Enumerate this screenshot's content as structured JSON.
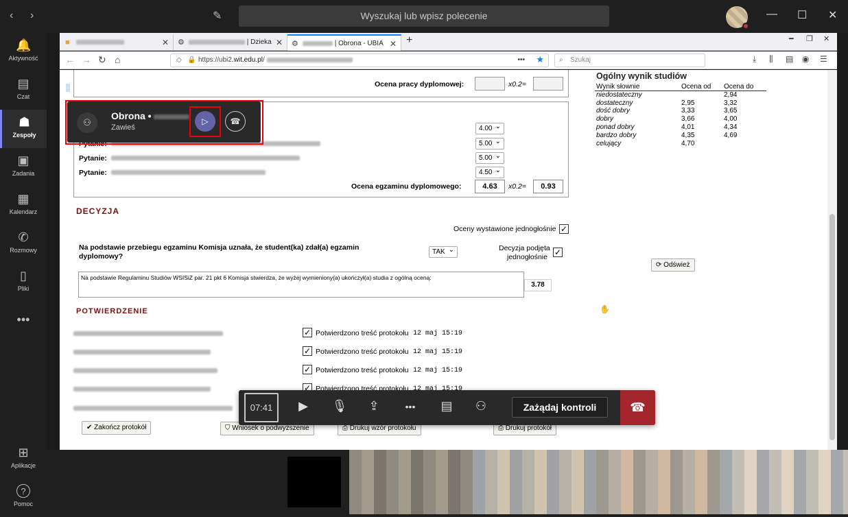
{
  "teams": {
    "search_placeholder": "Wyszukaj lub wpisz polecenie",
    "rail": [
      {
        "label": "Aktywność",
        "icon": "bell-icon",
        "glyph": "🔔"
      },
      {
        "label": "Czat",
        "icon": "chat-icon",
        "glyph": "▤"
      },
      {
        "label": "Zespoły",
        "icon": "teams-icon",
        "glyph": "☗",
        "active": true
      },
      {
        "label": "Zadania",
        "icon": "briefcase-icon",
        "glyph": "▣"
      },
      {
        "label": "Kalendarz",
        "icon": "calendar-icon",
        "glyph": "▦"
      },
      {
        "label": "Rozmowy",
        "icon": "phone-icon",
        "glyph": "✆"
      },
      {
        "label": "Pliki",
        "icon": "file-icon",
        "glyph": "▯"
      },
      {
        "label": "",
        "icon": "more-icon",
        "glyph": "•••"
      }
    ],
    "rail_bottom": [
      {
        "label": "Aplikacje",
        "icon": "apps-icon",
        "glyph": "⊞"
      },
      {
        "label": "Pomoc",
        "icon": "help-icon",
        "glyph": "?"
      }
    ],
    "call_card": {
      "title": "Obrona •",
      "subtitle": "Zawieś"
    },
    "controls": {
      "timer": "07:41",
      "request_control": "Zażądaj kontroli"
    }
  },
  "browser": {
    "tabs": [
      {
        "suffix": ""
      },
      {
        "suffix": "| Dzieka"
      },
      {
        "suffix": "| Obrona - UBIA",
        "active": true
      }
    ],
    "url_prefix": "https://ubi2.",
    "url_host": "wit.edu.pl",
    "url_suffix": "/",
    "search_placeholder": "Szukaj"
  },
  "form": {
    "ocena_pracy_label": "Ocena pracy dyplomowej:",
    "factor": "x0.2=",
    "questions": [
      {
        "label": "",
        "grade": "4.00"
      },
      {
        "label": "Pytanie:",
        "grade": "5.00"
      },
      {
        "label": "Pytanie:",
        "grade": "5.00"
      },
      {
        "label": "Pytanie:",
        "grade": "4.50"
      }
    ],
    "egzamin_label": "Ocena egzaminu dyplomowego:",
    "egzamin_value": "4.63",
    "egzamin_weighted": "0.93",
    "decyzja_heading": "DECYZJA",
    "oceny_jednoglosnie": "Oceny wystawione jednogłośnie",
    "question_line1": "Na podstawie przebiegu egzaminu Komisja uznała, że student(ka) zdał(a) egzamin",
    "question_line2": "dyplomowy?",
    "tak": "TAK",
    "decyzja_podjeta_1": "Decyzja podjęta",
    "decyzja_podjeta_2": "jednogłośnie",
    "regulamin_text": "Na podstawie Regulaminu Studiów WSISiZ par. 21 pkt 6 Komisja stwierdza, że wyżej wymieniony(a) ukończył(a) studia z ogólną oceną:",
    "final_grade": "3.78",
    "odswiez": "Odśwież",
    "potwierdzenie_heading": "POTWIERDZENIE",
    "confirmations": [
      {
        "text": "Potwierdzono treść protokołu",
        "date": "12 maj 15:19"
      },
      {
        "text": "Potwierdzono treść protokołu",
        "date": "12 maj 15:19"
      },
      {
        "text": "Potwierdzono treść protokołu",
        "date": "12 maj 15:19"
      },
      {
        "text": "Potwierdzono treść protokołu",
        "date": "12 maj 15:19"
      }
    ],
    "buttons": {
      "zakoncz": "Zakończ protokół",
      "wniosek": "Wniosek o podwyższenie",
      "drukuj_wzor": "Drukuj wzór protokołu",
      "drukuj": "Drukuj protokół"
    }
  },
  "grading": {
    "title": "Ogólny wynik studiów",
    "headers": [
      "Wynik słownie",
      "Ocena od",
      "Ocena do"
    ],
    "rows": [
      [
        "niedostateczny",
        "",
        "2,94"
      ],
      [
        "dostateczny",
        "2,95",
        "3,32"
      ],
      [
        "dość dobry",
        "3,33",
        "3,65"
      ],
      [
        "dobry",
        "3,66",
        "4,00"
      ],
      [
        "ponad dobry",
        "4,01",
        "4,34"
      ],
      [
        "bardzo dobry",
        "4,35",
        "4,69"
      ],
      [
        "celujący",
        "4,70",
        ""
      ]
    ]
  }
}
